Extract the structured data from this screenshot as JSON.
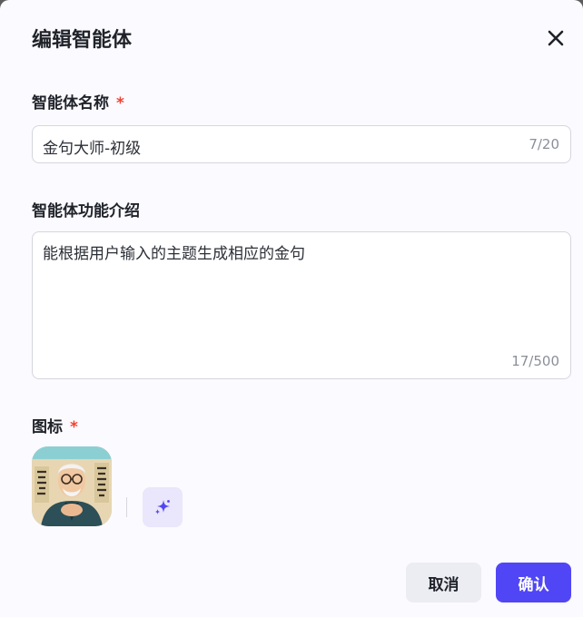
{
  "dialog": {
    "title": "编辑智能体",
    "close_icon": "close-icon"
  },
  "name_field": {
    "label": "智能体名称",
    "required_mark": "*",
    "value": "金句大师-初级",
    "counter": "7/20"
  },
  "description_field": {
    "label": "智能体功能介绍",
    "value": "能根据用户输入的主题生成相应的金句",
    "counter": "17/500"
  },
  "icon_field": {
    "label": "图标",
    "required_mark": "*",
    "avatar_icon": "avatar-image",
    "ai_generate_icon": "sparkle-icon"
  },
  "footer": {
    "cancel_label": "取消",
    "confirm_label": "确认"
  },
  "colors": {
    "primary": "#5146f6",
    "required": "#f2412e",
    "ai_button_bg": "#eae6fb"
  }
}
